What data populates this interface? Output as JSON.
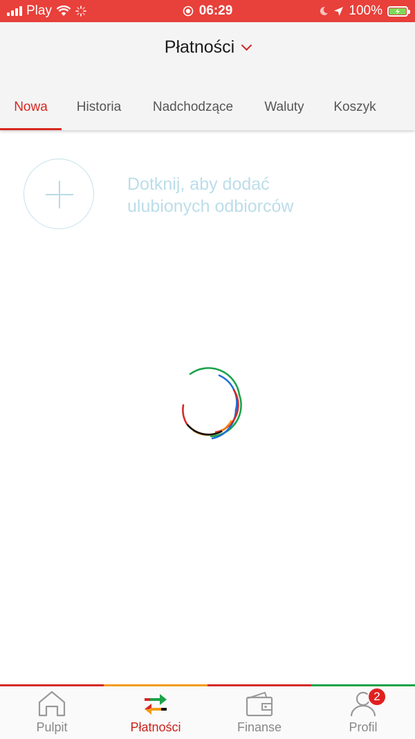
{
  "status_bar": {
    "carrier": "Play",
    "time": "06:29",
    "battery": "100%"
  },
  "header": {
    "title": "Płatności",
    "tabs": [
      {
        "label": "Nowa",
        "active": true
      },
      {
        "label": "Historia",
        "active": false
      },
      {
        "label": "Nadchodzące",
        "active": false
      },
      {
        "label": "Waluty",
        "active": false
      },
      {
        "label": "Koszyk",
        "active": false
      }
    ]
  },
  "favorites": {
    "hint_line1": "Dotknij, aby dodać",
    "hint_line2": "ulubionych odbiorców"
  },
  "bottom_nav": {
    "items": [
      {
        "label": "Pulpit",
        "icon": "home-icon",
        "active": false
      },
      {
        "label": "Płatności",
        "icon": "transfer-arrows-icon",
        "active": true
      },
      {
        "label": "Finanse",
        "icon": "wallet-icon",
        "active": false
      },
      {
        "label": "Profil",
        "icon": "profile-icon",
        "active": false,
        "badge": "2"
      }
    ]
  },
  "colors": {
    "accent": "#d7281f",
    "status_bar": "#e8403a",
    "header_bg": "#f4f4f4",
    "hint": "#bcdde9"
  }
}
